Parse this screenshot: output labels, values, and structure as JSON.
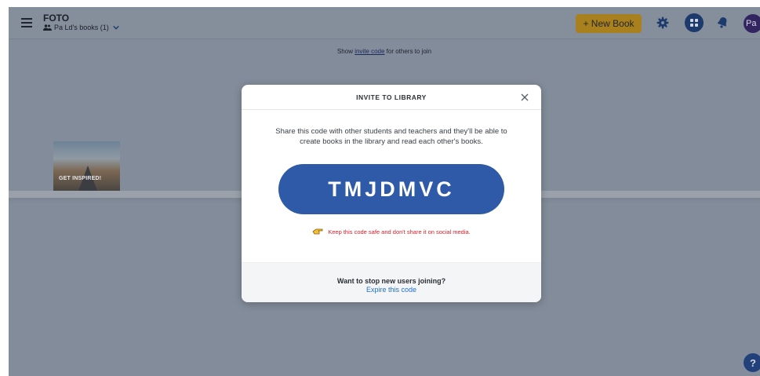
{
  "header": {
    "app_title": "FOTO",
    "library_name": "Pa Ld's books (1)",
    "new_book_label": "+ New Book",
    "avatar_initials": "Pa",
    "icons": [
      "menu-icon",
      "people-icon",
      "chevron-down-icon",
      "gear-icon",
      "grid-icon",
      "bell-icon"
    ]
  },
  "invite_hint": {
    "prefix": "Show ",
    "link": "invite code",
    "suffix": " for others to join"
  },
  "shelf": {
    "book_cover_text": "GET INSPIRED!"
  },
  "help_label": "?",
  "modal": {
    "title": "INVITE TO LIBRARY",
    "description": "Share this code with other students and teachers and they'll be able to create books in the library and read each other's books.",
    "code": "TMJDMVC",
    "warning": "Keep this code safe and don't share it on social media.",
    "footer_question": "Want to stop new users joining?",
    "footer_link": "Expire this code"
  },
  "colors": {
    "accent": "#2f5aa7",
    "new_book": "#a8811e",
    "warning": "#d9202a",
    "link": "#1f6fd6"
  }
}
